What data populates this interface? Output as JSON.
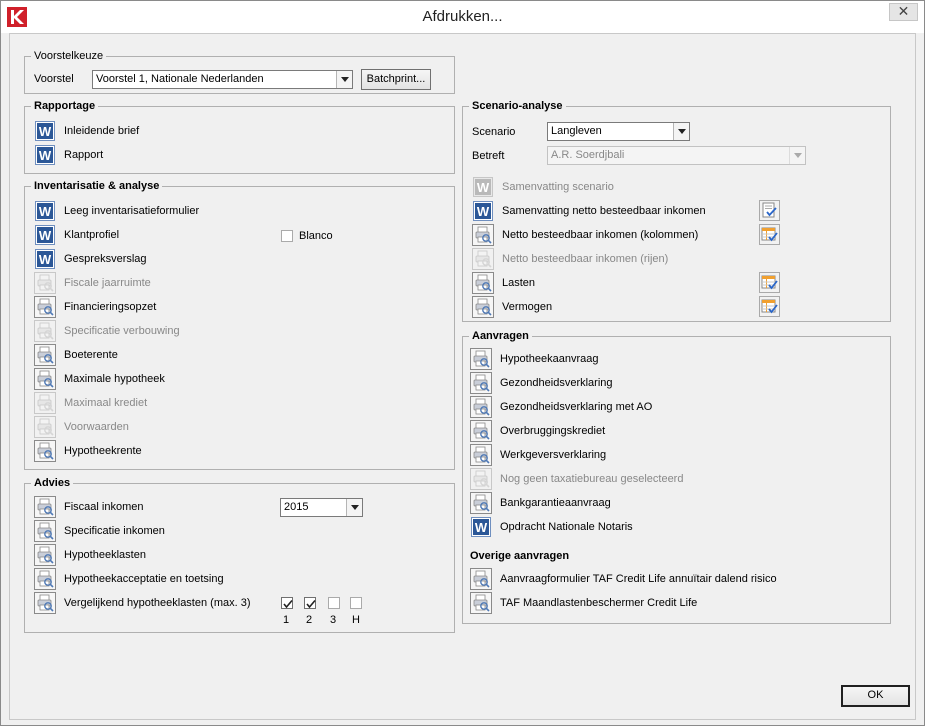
{
  "window": {
    "title": "Afdrukken..."
  },
  "voorstelkeuze": {
    "title": "Voorstelkeuze",
    "voorstel_label": "Voorstel",
    "voorstel_value": "Voorstel 1, Nationale Nederlanden",
    "batchprint_label": "Batchprint..."
  },
  "rapportage": {
    "title": "Rapportage",
    "items": [
      "Inleidende brief",
      "Rapport"
    ]
  },
  "inventarisatie": {
    "title": "Inventarisatie & analyse",
    "items": [
      "Leeg inventarisatieformulier",
      "Klantprofiel",
      "Gespreksverslag",
      "Fiscale jaarruimte",
      "Financieringsopzet",
      "Specificatie verbouwing",
      "Boeterente",
      "Maximale hypotheek",
      "Maximaal krediet",
      "Voorwaarden",
      "Hypotheekrente"
    ],
    "blanco_label": "Blanco"
  },
  "advies": {
    "title": "Advies",
    "items": [
      "Fiscaal inkomen",
      "Specificatie inkomen",
      "Hypotheeklasten",
      "Hypotheekacceptatie en toetsing",
      "Vergelijkend hypotheeklasten (max. 3)"
    ],
    "year_value": "2015",
    "compare_labels": [
      "1",
      "2",
      "3",
      "H"
    ]
  },
  "scenario": {
    "title": "Scenario-analyse",
    "scenario_label": "Scenario",
    "scenario_value": "Langleven",
    "betreft_label": "Betreft",
    "betreft_value": "A.R. Soerdjbali",
    "items": [
      "Samenvatting scenario",
      "Samenvatting netto besteedbaar inkomen",
      "Netto besteedbaar inkomen (kolommen)",
      "Netto besteedbaar inkomen (rijen)",
      "Lasten",
      "Vermogen"
    ]
  },
  "aanvragen": {
    "title": "Aanvragen",
    "items": [
      "Hypotheekaanvraag",
      "Gezondheidsverklaring",
      "Gezondheidsverklaring met AO",
      "Overbruggingskrediet",
      "Werkgeversverklaring",
      "Nog geen taxatiebureau geselecteerd",
      "Bankgarantieaanvraag",
      "Opdracht Nationale Notaris"
    ],
    "overige_title": "Overige aanvragen",
    "overige_items": [
      "Aanvraagformulier TAF Credit Life annuïtair dalend risico",
      "TAF Maandlastenbeschermer Credit Life"
    ]
  },
  "footer": {
    "ok_label": "OK"
  },
  "colors": {
    "word_blue": "#2b5797",
    "logo_red": "#d0202a"
  }
}
